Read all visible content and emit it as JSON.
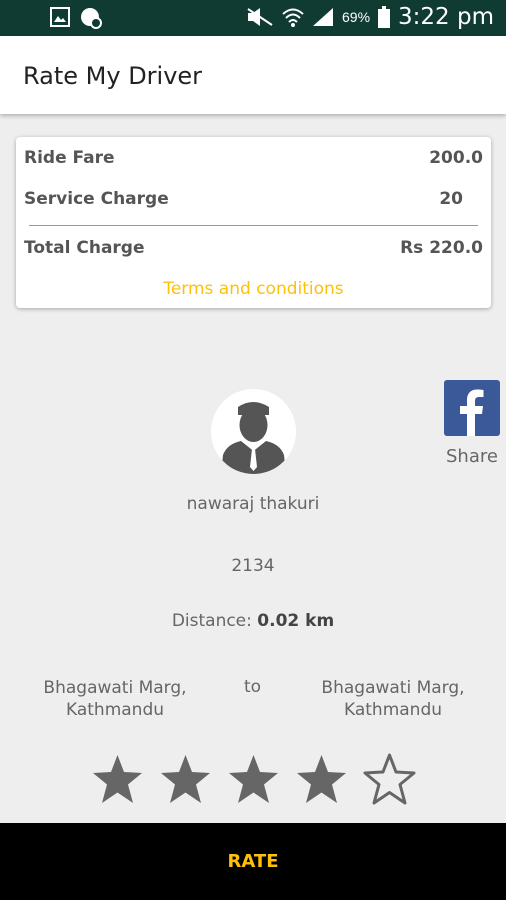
{
  "status_bar": {
    "battery": "69%",
    "time": "3:22 pm",
    "icons": [
      "image-icon",
      "chat-icon",
      "mute-icon",
      "wifi-icon",
      "signal-icon",
      "battery-icon"
    ]
  },
  "app_bar": {
    "title": "Rate My Driver"
  },
  "fare": {
    "ride_fare_label": "Ride Fare",
    "ride_fare_value": "200.0",
    "service_charge_label": "Service Charge",
    "service_charge_value": "20",
    "total_label": "Total Charge",
    "total_value": "Rs 220.0",
    "terms": "Terms and conditions"
  },
  "share": {
    "label": "Share",
    "icon": "facebook-icon"
  },
  "driver": {
    "name": "nawaraj thakuri",
    "id": "2134",
    "distance_label": "Distance:",
    "distance_value": "0.02 km"
  },
  "route": {
    "from": "Bhagawati Marg, Kathmandu",
    "to_label": "to",
    "to": "Bhagawati Marg, Kathmandu"
  },
  "rating": {
    "value": 4,
    "max": 5
  },
  "action": {
    "rate_label": "RATE"
  },
  "colors": {
    "accent": "#ffc107",
    "status_bar": "#0f3b33",
    "facebook": "#3b5998"
  }
}
